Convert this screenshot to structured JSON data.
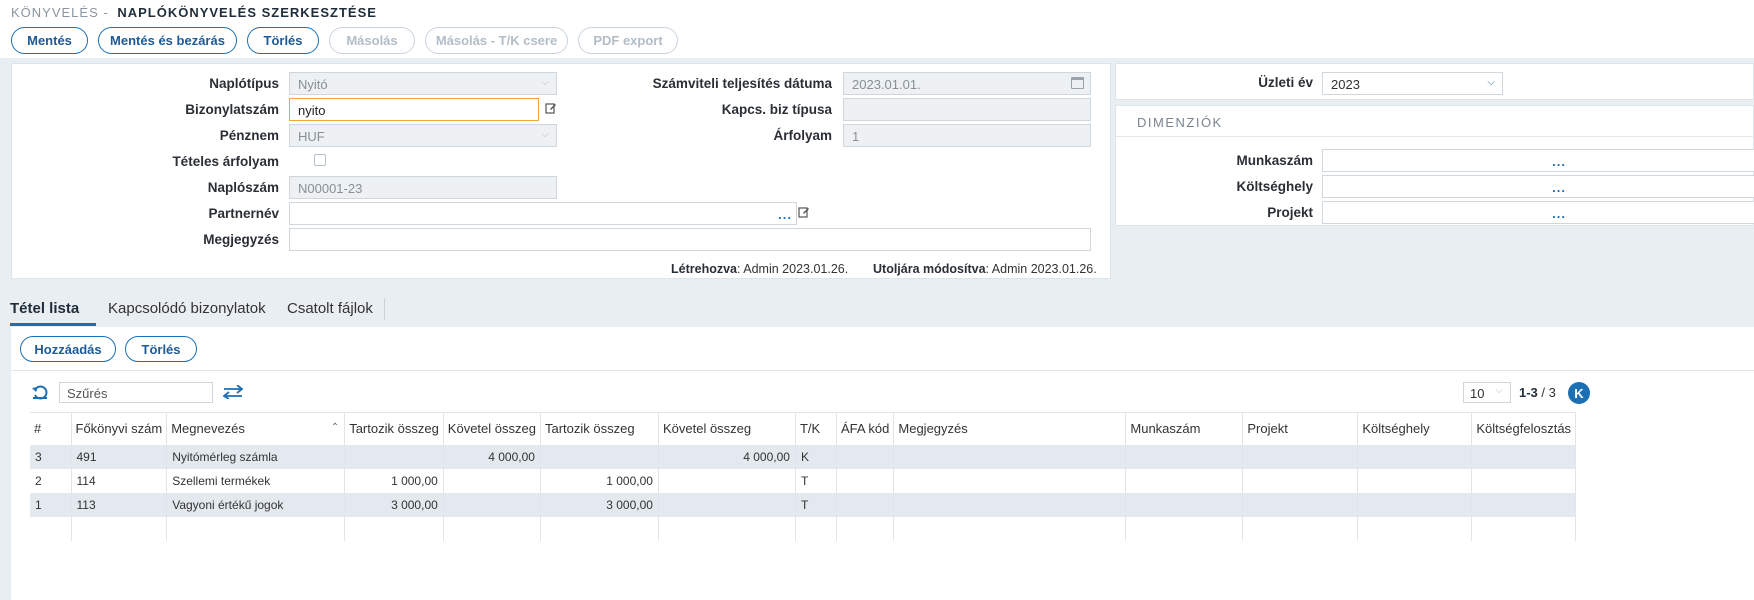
{
  "breadcrumb": {
    "root": "KÖNYVELÉS -",
    "current": "NAPLÓKÖNYVELÉS SZERKESZTÉSE"
  },
  "toolbar": {
    "save": "Mentés",
    "save_close": "Mentés és bezárás",
    "delete": "Törlés",
    "copy": "Másolás",
    "copy_swap": "Másolás - T/K csere",
    "pdf_export": "PDF export"
  },
  "form": {
    "journal_type_label": "Naplótípus",
    "journal_type_value": "Nyitó",
    "doc_number_label": "Bizonylatszám",
    "doc_number_value": "nyito",
    "currency_label": "Pénznem",
    "currency_value": "HUF",
    "itemized_rate_label": "Tételes árfolyam",
    "journal_number_label": "Naplószám",
    "journal_number_value": "N00001-23",
    "partner_label": "Partnernév",
    "partner_value": "",
    "note_label": "Megjegyzés",
    "note_value": "",
    "perf_date_label": "Számviteli teljesítés dátuma",
    "perf_date_value": "2023.01.01.",
    "linked_doc_type_label": "Kapcs. biz típusa",
    "linked_doc_type_value": "",
    "rate_label": "Árfolyam",
    "rate_value": "1",
    "created_label": "Létrehozva",
    "created_value": ": Admin 2023.01.26.",
    "modified_label": "Utoljára módosítva",
    "modified_value": ": Admin 2023.01.26."
  },
  "side": {
    "year_label": "Üzleti év",
    "year_value": "2023",
    "dimensions_title": "DIMENZIÓK",
    "work_number_label": "Munkaszám",
    "cost_center_label": "Költséghely",
    "project_label": "Projekt"
  },
  "tabs": {
    "items": "Tétel lista",
    "linked_docs": "Kapcsolódó bizonylatok",
    "attachments": "Csatolt fájlok"
  },
  "sub_toolbar": {
    "add": "Hozzáadás",
    "delete": "Törlés"
  },
  "grid_bar": {
    "filter_placeholder": "Szűrés",
    "page_size": "10",
    "range": "1-3",
    "total": " / 3",
    "first_page": "K"
  },
  "columns": [
    "#",
    "Főkönyvi szám",
    "Megnevezés",
    "Tartozik összeg",
    "Követel összeg",
    "Tartozik összeg",
    "Követel összeg",
    "T/K",
    "ÁFA kód",
    "Megjegyzés",
    "Munkaszám",
    "Projekt",
    "Költséghely",
    "Költségfelosztás"
  ],
  "rows": [
    {
      "idx": "3",
      "account": "491",
      "name": "Nyitómérleg számla",
      "debit": "",
      "credit": "4 000,00",
      "debit2": "",
      "credit2": "4 000,00",
      "tk": "K"
    },
    {
      "idx": "2",
      "account": "114",
      "name": "Szellemi termékek",
      "debit": "1 000,00",
      "credit": "",
      "debit2": "1 000,00",
      "credit2": "",
      "tk": "T"
    },
    {
      "idx": "1",
      "account": "113",
      "name": "Vagyoni értékű jogok",
      "debit": "3 000,00",
      "credit": "",
      "debit2": "3 000,00",
      "credit2": "",
      "tk": "T"
    }
  ],
  "colors": {
    "accent": "#1d6fb3",
    "row_alt": "#e3e9ef",
    "focus_border": "#f0a73a"
  }
}
